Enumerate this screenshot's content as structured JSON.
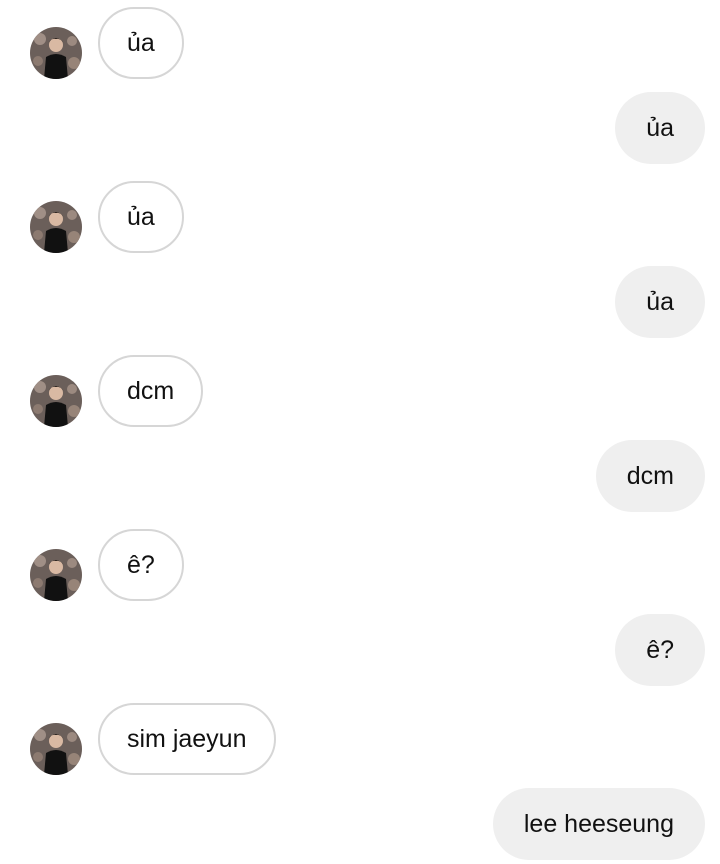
{
  "avatar_icon": "profile-photo-avatar",
  "messages": [
    {
      "side": "in",
      "text": "ủa"
    },
    {
      "side": "out",
      "text": "ủa"
    },
    {
      "side": "in",
      "text": "ủa"
    },
    {
      "side": "out",
      "text": "ủa"
    },
    {
      "side": "in",
      "text": "dcm"
    },
    {
      "side": "out",
      "text": "dcm"
    },
    {
      "side": "in",
      "text": "ê?"
    },
    {
      "side": "out",
      "text": "ê?"
    },
    {
      "side": "in",
      "text": "sim jaeyun"
    },
    {
      "side": "out",
      "text": "lee heeseung"
    }
  ],
  "colors": {
    "incoming_border": "#d6d6d6",
    "outgoing_background": "#efefef",
    "text": "#111111"
  }
}
